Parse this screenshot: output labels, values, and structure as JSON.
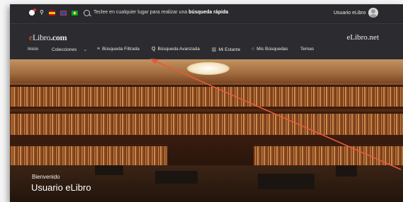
{
  "topbar": {
    "languages": [
      "es",
      "en",
      "pt"
    ],
    "search_text": "Teclee en cualquier lugar para realizar una",
    "search_bold": "búsqueda rápida",
    "user_name": "Usuario eLibro"
  },
  "brand": {
    "logo_e": "e",
    "logo_libro": "Libro",
    "logo_com": ".com",
    "right": "eLibro.net"
  },
  "nav": {
    "items": [
      {
        "label": "Inicio"
      },
      {
        "label": "Colecciones",
        "caret": "⌄"
      },
      {
        "label": "Búsqueda Filtrada",
        "icon": "≡"
      },
      {
        "label": "Búsqueda Avanzada",
        "icon": "Q"
      },
      {
        "label": "Mi Estante",
        "icon": "▥"
      },
      {
        "label": "Mis Búsquedas",
        "icon": "○"
      },
      {
        "label": "Temas"
      }
    ]
  },
  "hero": {
    "welcome": "Bienvenido",
    "user": "Usuario eLibro"
  },
  "colors": {
    "topbar": "#2a2a2e",
    "annotation_arrow": "#e8593a",
    "logo_accent": "#e2602c"
  }
}
